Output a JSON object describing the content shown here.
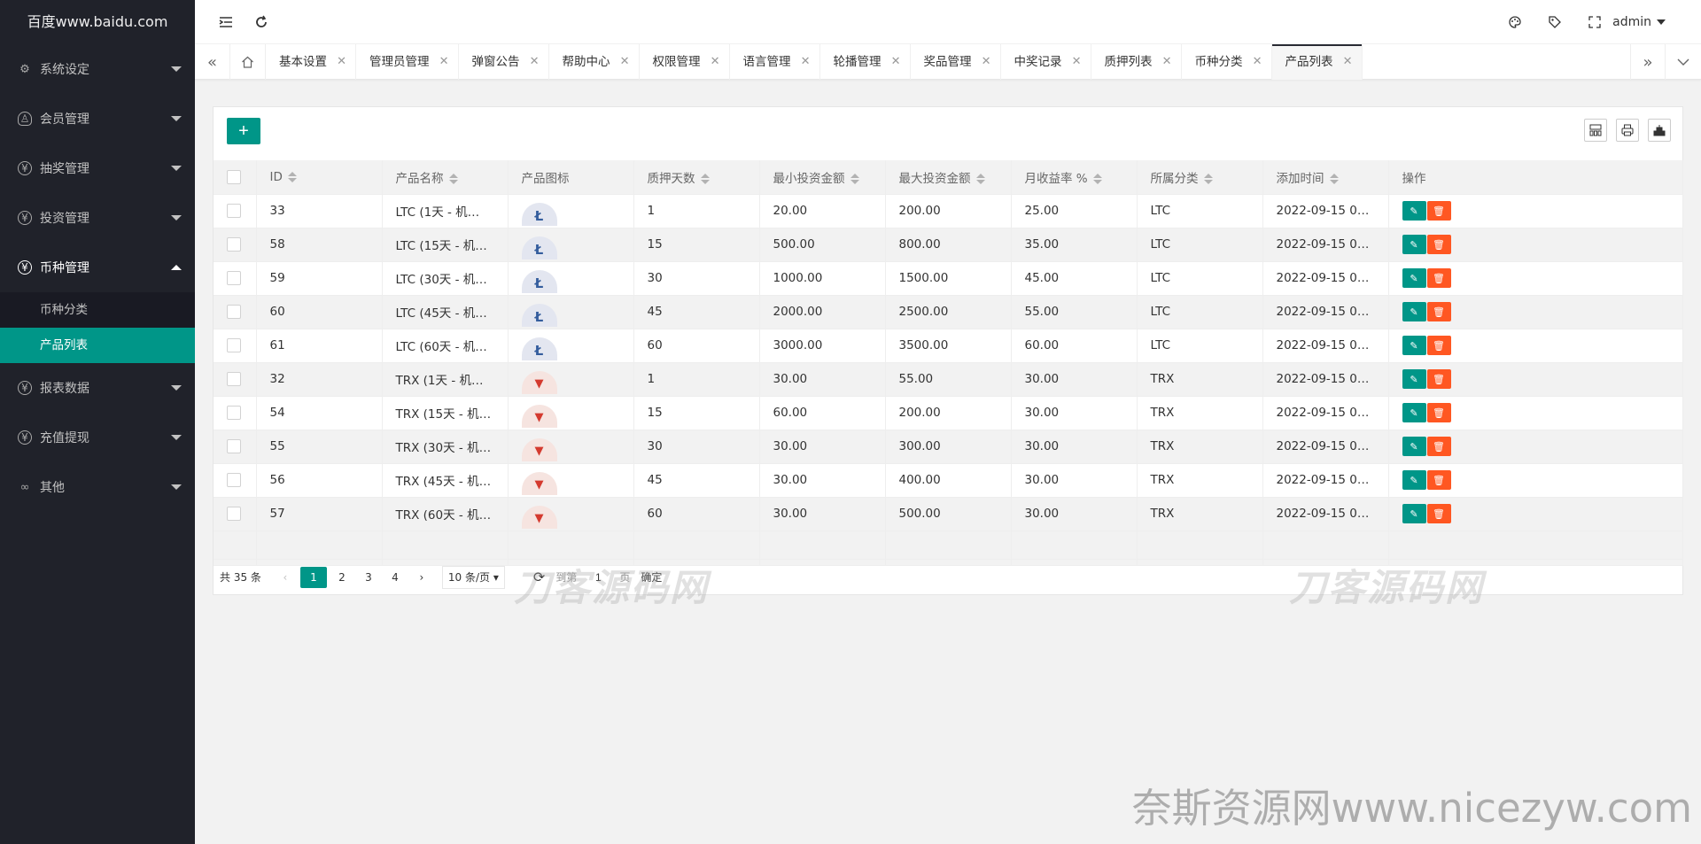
{
  "app": {
    "logo": "百度www.baidu.com",
    "user": "admin"
  },
  "sidebar": {
    "items": [
      {
        "label": "系统设定",
        "icon": "gear-icon",
        "glyph": "⚙"
      },
      {
        "label": "会员管理",
        "icon": "user-icon",
        "glyph": "♙"
      },
      {
        "label": "抽奖管理",
        "icon": "yen-icon",
        "glyph": "¥"
      },
      {
        "label": "投资管理",
        "icon": "yen-icon",
        "glyph": "¥"
      },
      {
        "label": "币种管理",
        "icon": "yen-icon",
        "glyph": "¥",
        "open": true,
        "children": [
          {
            "label": "币种分类"
          },
          {
            "label": "产品列表",
            "active": true
          }
        ]
      },
      {
        "label": "报表数据",
        "icon": "yen-icon",
        "glyph": "¥"
      },
      {
        "label": "充值提现",
        "icon": "yen-icon",
        "glyph": "¥"
      },
      {
        "label": "其他",
        "icon": "link-icon",
        "glyph": "∞"
      }
    ]
  },
  "tabs": [
    "基本设置",
    "管理员管理",
    "弹窗公告",
    "帮助中心",
    "权限管理",
    "语言管理",
    "轮播管理",
    "奖品管理",
    "中奖记录",
    "质押列表",
    "币种分类",
    "产品列表"
  ],
  "active_tab": "产品列表",
  "table": {
    "columns": [
      "ID",
      "产品名称",
      "产品图标",
      "质押天数",
      "最小投资金额",
      "最大投资金额",
      "月收益率 %",
      "所属分类",
      "添加时间",
      "操作"
    ],
    "rows": [
      {
        "id": "33",
        "name": "LTC (1天 - 机…",
        "coin": "ltc",
        "days": "1",
        "min": "20.00",
        "max": "200.00",
        "rate": "25.00",
        "cat": "LTC",
        "time": "2022-09-15 01…"
      },
      {
        "id": "58",
        "name": "LTC (15天 - 机…",
        "coin": "ltc",
        "days": "15",
        "min": "500.00",
        "max": "800.00",
        "rate": "35.00",
        "cat": "LTC",
        "time": "2022-09-15 01…"
      },
      {
        "id": "59",
        "name": "LTC (30天 - 机…",
        "coin": "ltc",
        "days": "30",
        "min": "1000.00",
        "max": "1500.00",
        "rate": "45.00",
        "cat": "LTC",
        "time": "2022-09-15 01…"
      },
      {
        "id": "60",
        "name": "LTC (45天 - 机…",
        "coin": "ltc",
        "days": "45",
        "min": "2000.00",
        "max": "2500.00",
        "rate": "55.00",
        "cat": "LTC",
        "time": "2022-09-15 01…"
      },
      {
        "id": "61",
        "name": "LTC (60天 - 机…",
        "coin": "ltc",
        "days": "60",
        "min": "3000.00",
        "max": "3500.00",
        "rate": "60.00",
        "cat": "LTC",
        "time": "2022-09-15 01…"
      },
      {
        "id": "32",
        "name": "TRX (1天 - 机…",
        "coin": "trx",
        "days": "1",
        "min": "30.00",
        "max": "55.00",
        "rate": "30.00",
        "cat": "TRX",
        "time": "2022-09-15 01…"
      },
      {
        "id": "54",
        "name": "TRX (15天 - 机…",
        "coin": "trx",
        "days": "15",
        "min": "60.00",
        "max": "200.00",
        "rate": "30.00",
        "cat": "TRX",
        "time": "2022-09-15 01…"
      },
      {
        "id": "55",
        "name": "TRX (30天 - 机…",
        "coin": "trx",
        "days": "30",
        "min": "30.00",
        "max": "300.00",
        "rate": "30.00",
        "cat": "TRX",
        "time": "2022-09-15 01…"
      },
      {
        "id": "56",
        "name": "TRX (45天 - 机…",
        "coin": "trx",
        "days": "45",
        "min": "30.00",
        "max": "400.00",
        "rate": "30.00",
        "cat": "TRX",
        "time": "2022-09-15 01…"
      },
      {
        "id": "57",
        "name": "TRX (60天 - 机…",
        "coin": "trx",
        "days": "60",
        "min": "30.00",
        "max": "500.00",
        "rate": "30.00",
        "cat": "TRX",
        "time": "2022-09-15 01…"
      }
    ]
  },
  "pager": {
    "count": "共 35 条",
    "pages": [
      "1",
      "2",
      "3",
      "4"
    ],
    "current": "1",
    "size": "10 条/页",
    "goto_label": "到第",
    "goto_value": "1",
    "page_unit": "页",
    "confirm": "确定"
  },
  "watermark": {
    "faint": "刀客源码网",
    "footer": "奈斯资源网www.nicezyw.com"
  },
  "colors": {
    "accent": "#009688",
    "danger": "#ff5722",
    "sidebar": "#20222a"
  }
}
